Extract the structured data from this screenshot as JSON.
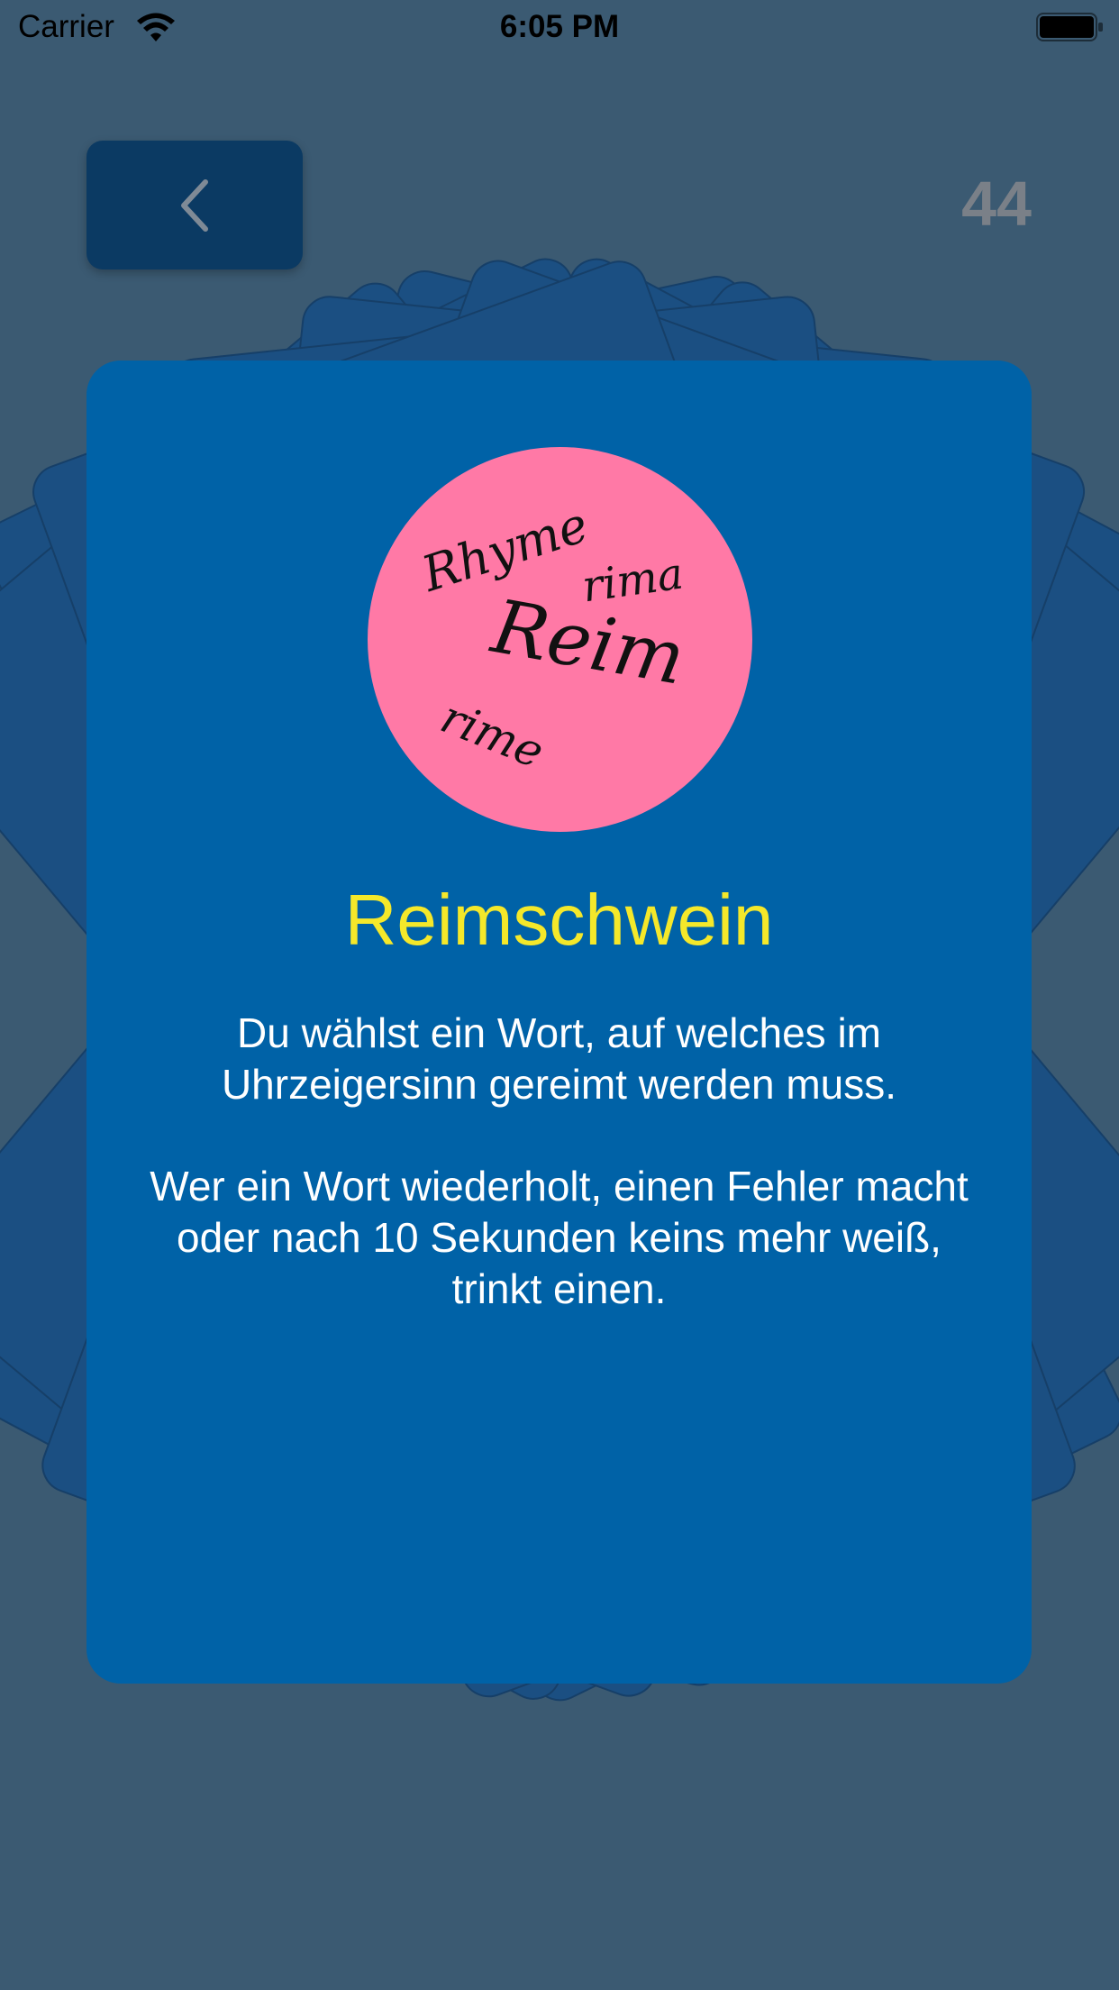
{
  "status_bar": {
    "carrier": "Carrier",
    "time": "6:05 PM",
    "wifi_icon": "wifi-icon",
    "battery_icon": "battery-icon"
  },
  "nav": {
    "back_icon": "chevron-left-icon",
    "counter": "44"
  },
  "card": {
    "logo": {
      "words": [
        "Rhyme",
        "rima",
        "Reim",
        "rime"
      ]
    },
    "title": "Reimschwein",
    "paragraphs": [
      "Du wählst ein Wort, auf welches im Uhrzeigersinn gereimt werden muss.",
      "Wer ein Wort wiederholt, einen Fehler macht oder nach 10 Sekunden keins mehr weiß, trinkt einen."
    ],
    "colors": {
      "card": "#0062a7",
      "title": "#f5e82a",
      "logo_bg": "#ff79a6",
      "page_bg": "#3b5a72"
    }
  }
}
